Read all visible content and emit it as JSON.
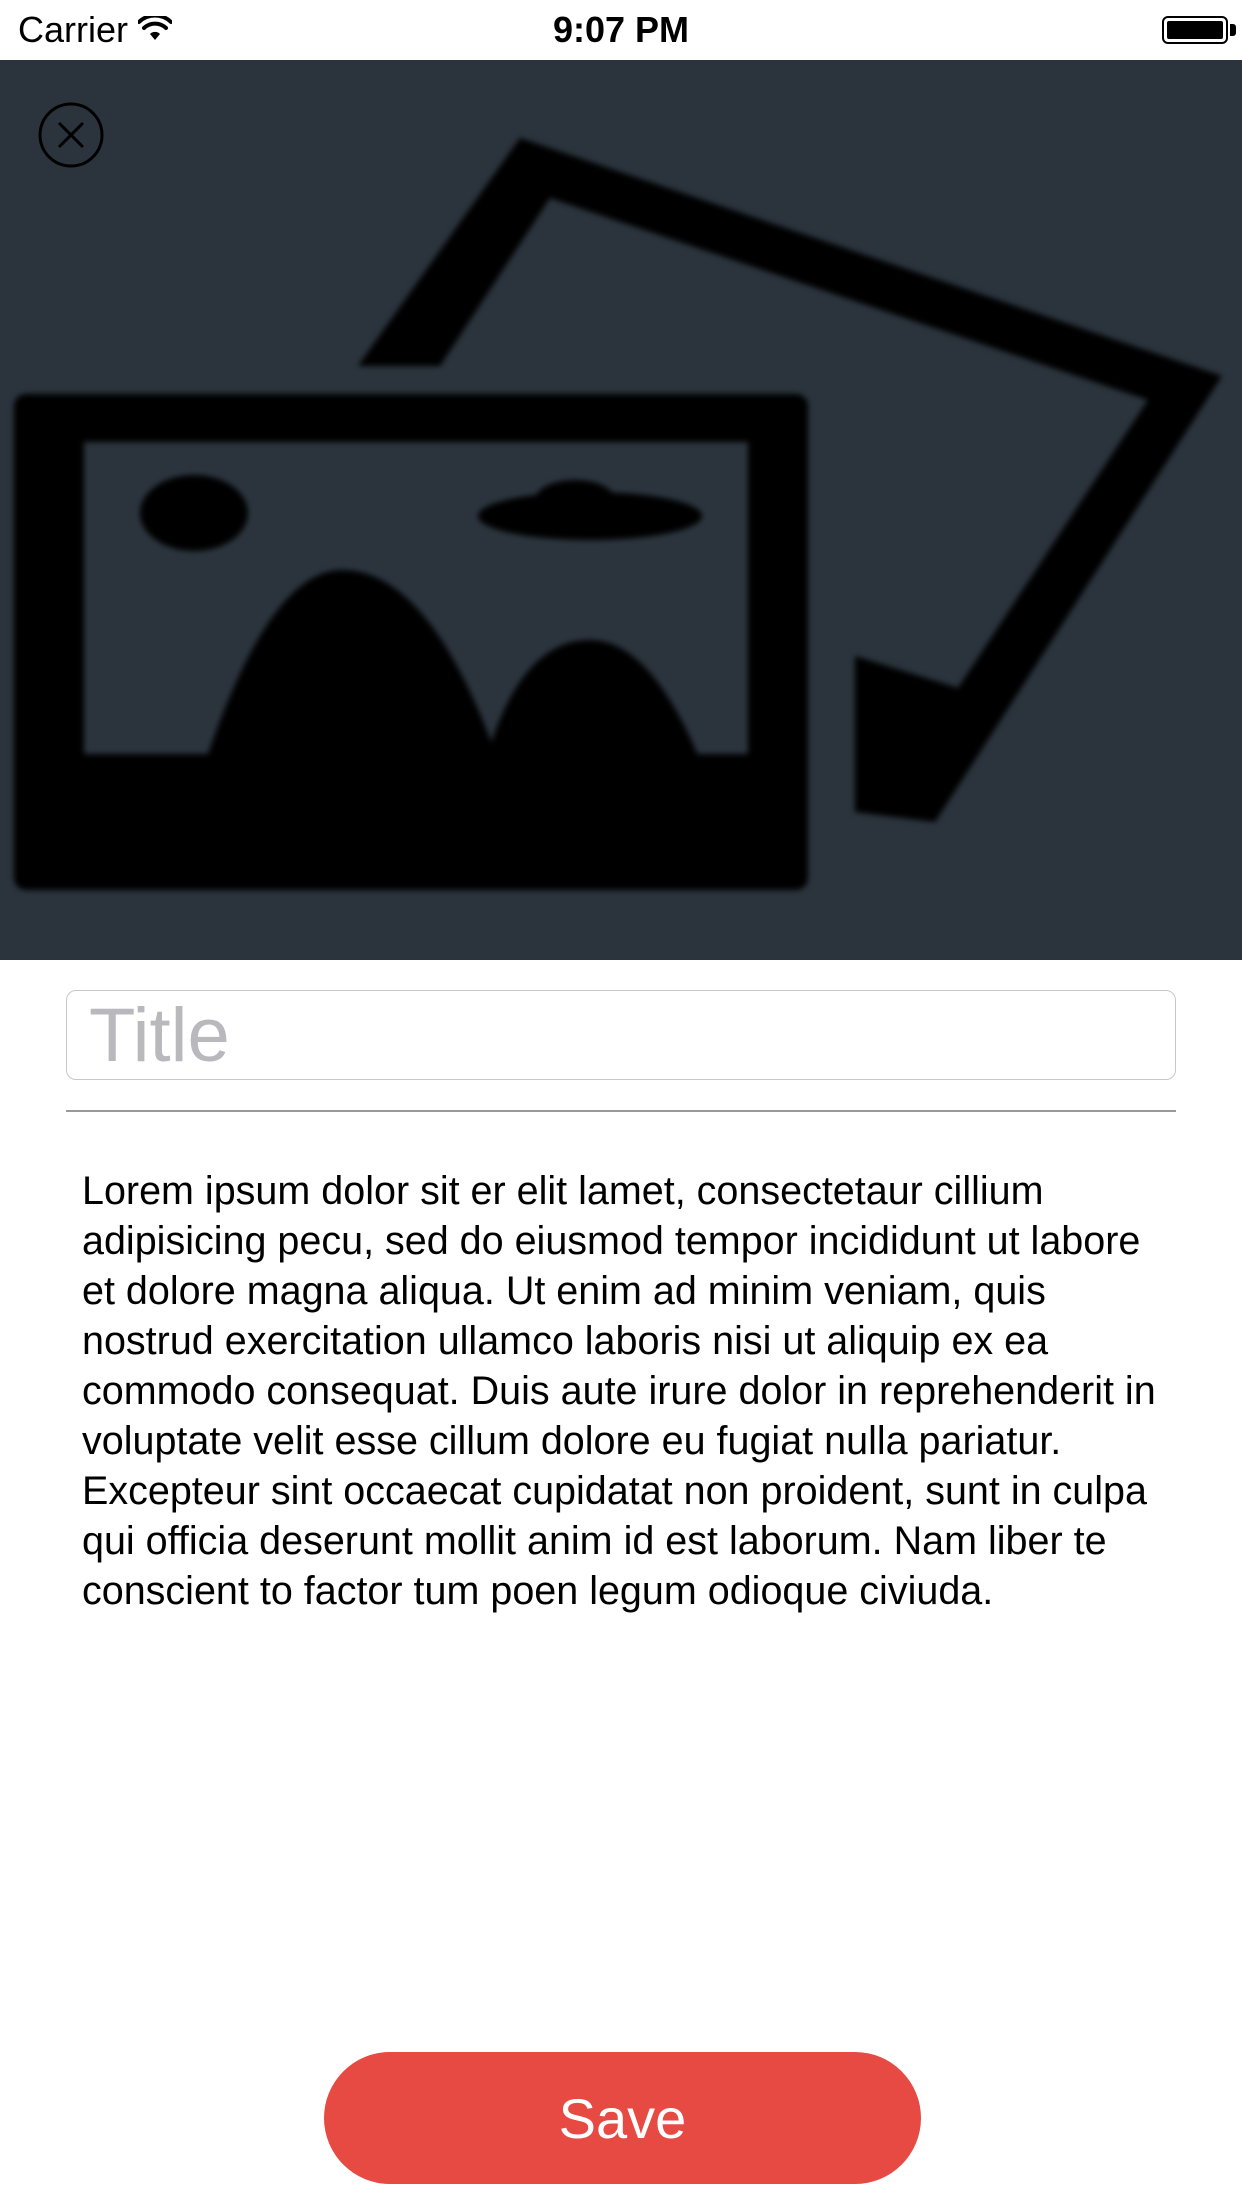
{
  "status_bar": {
    "carrier": "Carrier",
    "time": "9:07 PM"
  },
  "hero": {
    "background_color": "#2b343d",
    "image_icon": "photo-placeholder-icon",
    "close_icon": "close-circle-icon"
  },
  "form": {
    "title_placeholder": "Title",
    "title_value": "",
    "body_text": "Lorem ipsum dolor sit er elit lamet, consectetaur cillium adipisicing pecu, sed do eiusmod tempor incididunt ut labore et dolore magna aliqua. Ut enim ad minim veniam, quis nostrud exercitation ullamco laboris nisi ut aliquip ex ea commodo consequat. Duis aute irure dolor in reprehenderit in voluptate velit esse cillum dolore eu fugiat nulla pariatur. Excepteur sint occaecat cupidatat non proident, sunt in culpa qui officia deserunt mollit anim id est laborum. Nam liber te conscient to factor tum poen legum odioque civiuda."
  },
  "actions": {
    "save_label": "Save",
    "save_color": "#e64a43"
  }
}
